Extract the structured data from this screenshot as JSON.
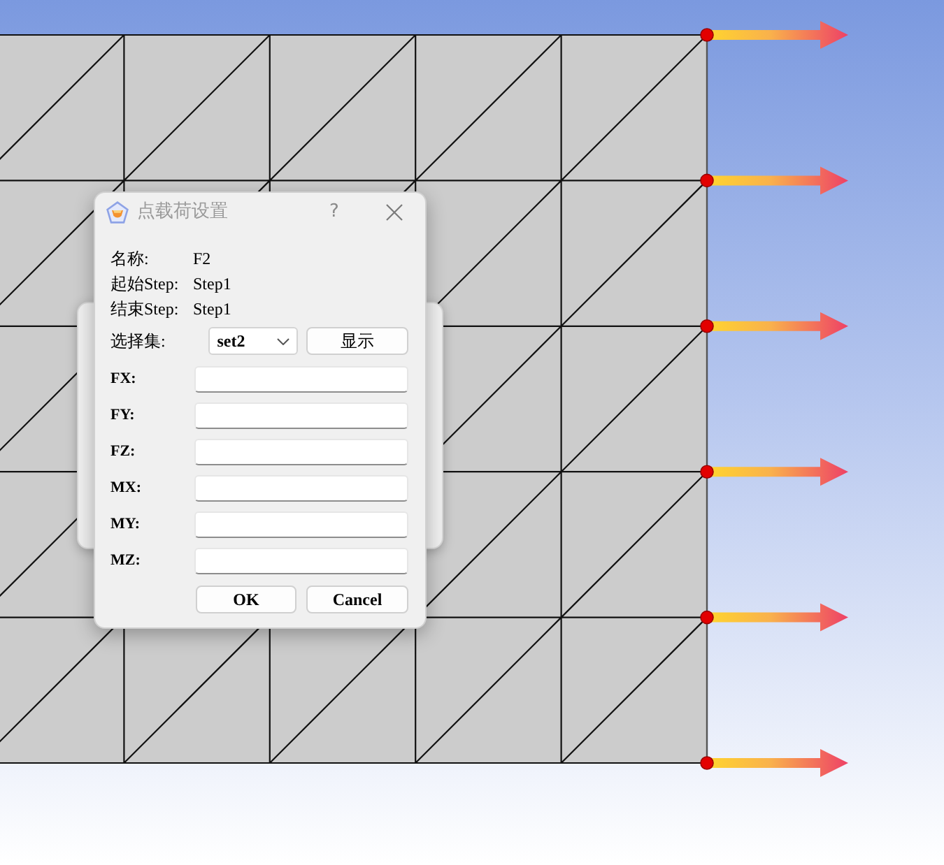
{
  "dialog": {
    "title": "点载荷设置",
    "active": false,
    "help": "?",
    "info": [
      {
        "label": "名称:",
        "value": "F2"
      },
      {
        "label": "起始Step:",
        "value": "Step1"
      },
      {
        "label": "结束Step:",
        "value": "Step1"
      }
    ],
    "selection_set": {
      "label": "选择集:",
      "value": "set2"
    },
    "show_button": "显示",
    "fields": [
      {
        "label": "FX:"
      },
      {
        "label": "FY:"
      },
      {
        "label": "FZ:"
      },
      {
        "label": "MX:"
      },
      {
        "label": "MY:"
      },
      {
        "label": "MZ:"
      }
    ],
    "buttons": [
      "OK",
      "Cancel"
    ]
  }
}
